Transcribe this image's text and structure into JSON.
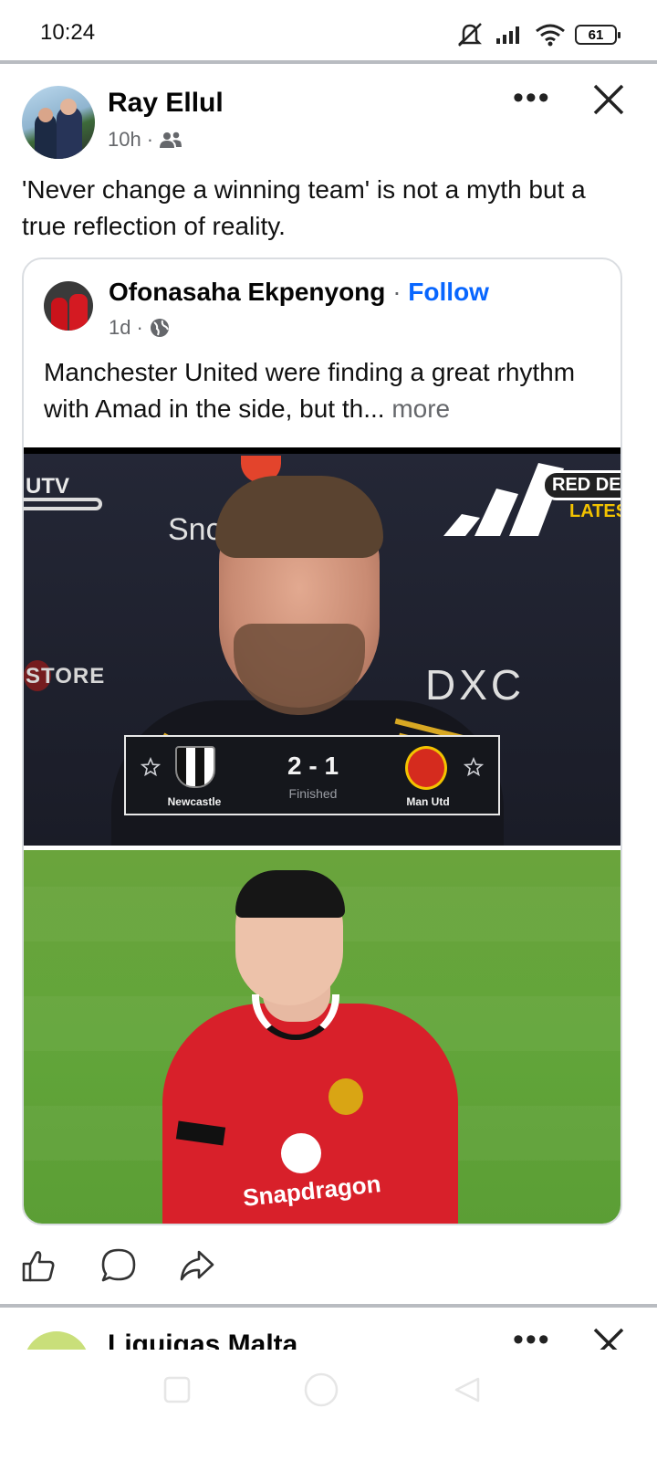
{
  "status_bar": {
    "time": "10:24",
    "battery": "61",
    "icons": [
      "mute-icon",
      "signal-icon",
      "wifi-icon",
      "battery-icon"
    ]
  },
  "post": {
    "author": "Ray Ellul",
    "time": "10h",
    "audience_icon": "friends-icon",
    "text": "'Never change a winning team'  is not a myth but a true reflection of reality.",
    "menu_icon": "more-options-icon",
    "close_icon": "close-icon"
  },
  "shared": {
    "author": "Ofonasaha Ekpenyong",
    "separator": "·",
    "follow_label": "Follow",
    "time": "1d",
    "audience_icon": "globe-icon",
    "text": "Manchester United were finding a great rhythm with Amad in the side, but th...",
    "more_label": "more",
    "image1": {
      "utv": "UTV",
      "sponsor_text": "Snc",
      "tag_top": "RED DEV",
      "tag_bottom": "LATES",
      "store": "STORE",
      "dxc": "DXC",
      "scoreboard": {
        "home": "Newcastle",
        "away": "Man Utd",
        "score": "2 - 1",
        "status": "Finished"
      }
    },
    "image2": {
      "shirt_sponsor": "Snapdragon"
    }
  },
  "actions": {
    "like_icon": "like-icon",
    "comment_icon": "comment-icon",
    "share_icon": "share-icon"
  },
  "next_post": {
    "author": "Liquigas Malta"
  },
  "colors": {
    "link": "#0866ff",
    "muted": "#65676b",
    "divider": "#b9bcc1"
  }
}
